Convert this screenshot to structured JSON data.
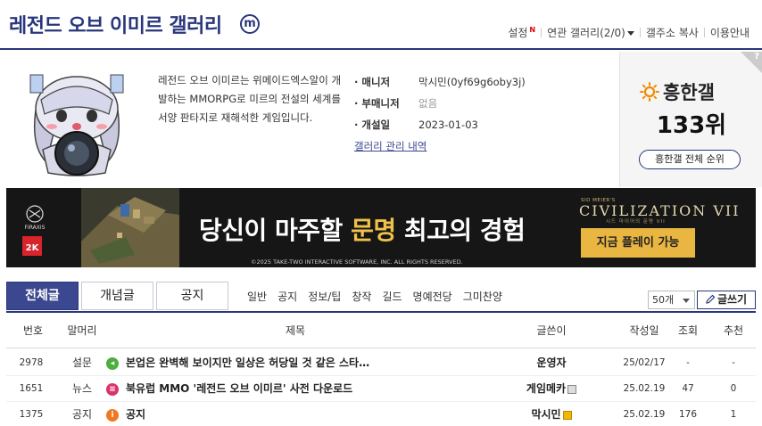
{
  "header": {
    "title": "레전드 오브 이미르 갤러리",
    "m_badge": "m",
    "links": {
      "settings": "설정",
      "settings_new": "N",
      "related": "연관 갤러리(2/0)",
      "copy_address": "갤주소 복사",
      "guide": "이용안내"
    }
  },
  "info": {
    "description": "레전드 오브 이미르는 위메이드엑스알이 개발하는 MMORPG로 미르의 전설의 세계를 서양 판타지로 재해석한 게임입니다.",
    "manager_label": "매니저",
    "manager_value": "막시민(0yf69g6oby3j)",
    "submanager_label": "부매니저",
    "submanager_value": "없음",
    "opened_label": "개설일",
    "opened_value": "2023-01-03",
    "admin_link": "갤러리 관리 내역"
  },
  "rank": {
    "question": "?",
    "title": "흥한갤",
    "value": "133위",
    "button": "흥한갤 전체 순위"
  },
  "banner": {
    "logo_top": "FIRAXIS",
    "logo_bottom": "2K",
    "headline_prefix": "당신이 마주할 ",
    "headline_highlight": "문명",
    "headline_suffix": " 최고의 경험",
    "copyright": "©2025 TAKE-TWO INTERACTIVE SOFTWARE, INC. ALL RIGHTS RESERVED.",
    "game_sub": "SID MEIER'S",
    "game_title": "CIVILIZATION VII",
    "game_tag": "시드 마이어의 문명 VII",
    "cta": "지금 플레이 가능"
  },
  "tabs": {
    "all": "전체글",
    "concept": "개념글",
    "notice": "공지"
  },
  "sub_tabs": [
    "일반",
    "공지",
    "정보/팁",
    "창작",
    "길드",
    "명예전당",
    "그미찬양"
  ],
  "list_controls": {
    "count": "50개",
    "write": "글쓰기"
  },
  "table": {
    "headers": {
      "no": "번호",
      "head": "말머리",
      "title": "제목",
      "author": "글쓴이",
      "date": "작성일",
      "views": "조회",
      "recommend": "추천"
    },
    "rows": [
      {
        "no": "2978",
        "head": "설문",
        "title": "본업은 완벽해 보이지만 일상은 허당일 것 같은 스타…",
        "author": "운영자",
        "date": "25/02/17",
        "views": "-",
        "recommend": "-",
        "icon": "survey-icon",
        "icon_glyph": "◂"
      },
      {
        "no": "1651",
        "head": "뉴스",
        "title": "북유럽 MMO '레전드 오브 이미르' 사전 다운로드",
        "author": "게임메카",
        "date": "25.02.19",
        "views": "47",
        "recommend": "0",
        "icon": "news-icon",
        "icon_glyph": "≡"
      },
      {
        "no": "1375",
        "head": "공지",
        "title": "공지",
        "author": "막시민",
        "date": "25.02.19",
        "views": "176",
        "recommend": "1",
        "icon": "notice-icon",
        "icon_glyph": "i"
      }
    ]
  },
  "colors": {
    "brand": "#29367c",
    "tab_active": "#3b4890",
    "banner_bg": "#161616",
    "banner_highlight": "#f0c04a",
    "cta": "#e9b642",
    "new_badge": "#e0000b"
  }
}
